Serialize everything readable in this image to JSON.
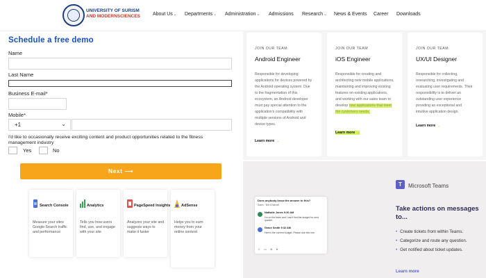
{
  "header": {
    "logo_line1": "UNIVERSITY OF SURISM",
    "logo_line2": "AND MODERNSCIENCES",
    "nav": [
      {
        "label": "About Us",
        "dropdown": true
      },
      {
        "label": "Departments",
        "dropdown": true
      },
      {
        "label": "Administration",
        "dropdown": true
      },
      {
        "label": "Admissions",
        "dropdown": false
      },
      {
        "label": "Research",
        "dropdown": true
      },
      {
        "label": "News & Events",
        "dropdown": false
      },
      {
        "label": "Career",
        "dropdown": false
      },
      {
        "label": "Downloads",
        "dropdown": false
      }
    ]
  },
  "form": {
    "title": "Schedule a free demo",
    "name_label": "Name",
    "last_name_label": "Last Name",
    "email_label": "Business E-mail*",
    "mobile_label": "Mobile*",
    "country_code": "+1",
    "consent_text": "I'd like to occasionally receive exciting content and product opportunities related to the fitness management industry",
    "yes_label": "Yes",
    "no_label": "No",
    "next_label": "Next"
  },
  "tools": [
    {
      "name": "Search Console",
      "desc": "Measure your sites Google Search traffic and performance",
      "icon_color": "#4a6fd6"
    },
    {
      "name": "Analytics",
      "desc": "Tells you how users find, use, and engage with your site",
      "icon_color": "#2fa84f"
    },
    {
      "name": "PageSpeed Insights",
      "desc": "Analyzes your site and suggests ways to make it faster",
      "icon_color": "#e0524a"
    },
    {
      "name": "AdSense",
      "desc": "Helps you to earn money from your online content",
      "icon_color": "#f2b233"
    }
  ],
  "jobs": [
    {
      "eyebrow": "JOIN OUR TEAM",
      "title": "Android Engineer",
      "desc": "Responsible for developing applications for devices powered by the Android operating system. Due to the fragmentation of this ecosystem, an Android developer must pay special attention to the application's compatibility with multiple versions of Android and device types.",
      "desc_highlight": "",
      "more": "Learn more"
    },
    {
      "eyebrow": "JOIN OUR TEAM",
      "title": "iOS Engineer",
      "desc": "Responsible for creating and architecting new mobile applications, maintaining and improving existing features on existing applications, and working with our sales team to develop",
      "desc_highlight": "new applications that meet the customers needs.",
      "more": "Learn more"
    },
    {
      "eyebrow": "JOIN OUR TEAM",
      "title": "UX/UI Designer",
      "desc": "Responsible for collecting, researching, investigating and evaluating user requirements. Their responsibility is to deliver an outstanding user experience providing an exceptional and intuitive application design.",
      "desc_highlight": "",
      "more": "Learn more"
    }
  ],
  "teams": {
    "brand": "Microsoft Teams",
    "headline": "Take actions on messages to...",
    "bullets": [
      "Create tickets from within Teams.",
      "Categorize and route any question.",
      "Get notified about ticket updates."
    ],
    "more": "Learn more",
    "mock": {
      "header": "Does anybody know the answer to this?",
      "sub": "Sales · Bot Channel",
      "messages": [
        {
          "name": "Nathalie Jones",
          "time": "9:30 AM",
          "text": "I'm on the team and I can't find the budget for next quarter."
        },
        {
          "name": "Grace Smith",
          "time": "9:32 AM",
          "text": "Here's the current budget. Please use this one."
        }
      ]
    }
  }
}
